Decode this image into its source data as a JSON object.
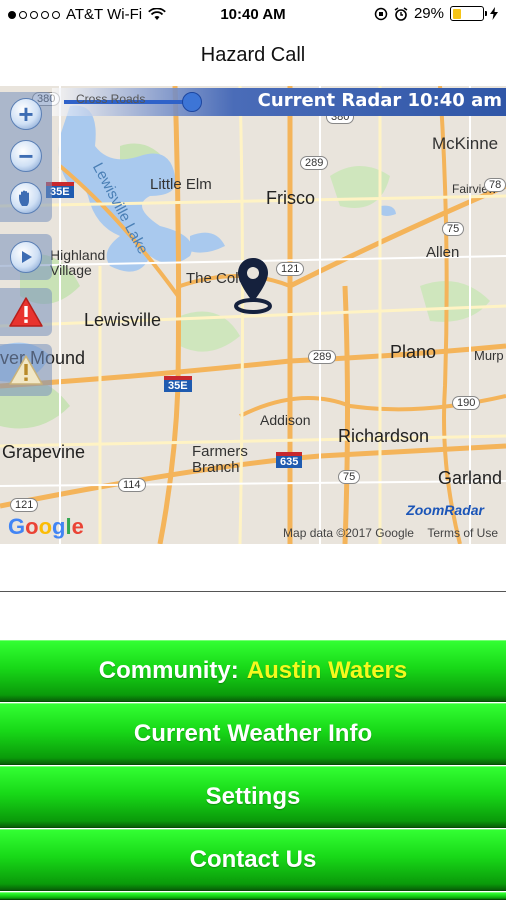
{
  "status_bar": {
    "carrier": "AT&T Wi-Fi",
    "time": "10:40 AM",
    "battery": "29%",
    "battery_level": 0.29,
    "signal_dots_filled": 1,
    "signal_dots_total": 5
  },
  "nav": {
    "title": "Hazard Call"
  },
  "map": {
    "radar_title": "Current Radar 10:40 am",
    "radar_road_label": "Cross Roads",
    "radar_shield": "75",
    "attribution": "Map data ©2017 Google",
    "terms": "Terms of Use",
    "google_logo": "Google",
    "zoomradar_logo": "ZoomRadar",
    "controls": {
      "zoom_in": "+",
      "zoom_out": "−",
      "pan": "hand-icon",
      "play": "play-icon",
      "alert": "!",
      "warning": "!"
    },
    "places": [
      {
        "key": "mckinney",
        "text": "McKinne"
      },
      {
        "key": "little_elm",
        "text": "Little Elm"
      },
      {
        "key": "frisco",
        "text": "Frisco"
      },
      {
        "key": "fairview",
        "text": "Fairview"
      },
      {
        "key": "highland_village",
        "text": "Highland Village"
      },
      {
        "key": "the_colony",
        "text": "The Colo"
      },
      {
        "key": "allen",
        "text": "Allen"
      },
      {
        "key": "lewisville",
        "text": "Lewisville"
      },
      {
        "key": "plano",
        "text": "Plano"
      },
      {
        "key": "murphy",
        "text": "Murp"
      },
      {
        "key": "flower_mound",
        "text": "ver Mound"
      },
      {
        "key": "addison",
        "text": "Addison"
      },
      {
        "key": "richardson",
        "text": "Richardson"
      },
      {
        "key": "grapevine",
        "text": "Grapevine"
      },
      {
        "key": "farmers_branch",
        "text": "Farmers Branch"
      },
      {
        "key": "garland",
        "text": "Garland"
      },
      {
        "key": "lewisville_lake",
        "text": "Lewisville Lake"
      }
    ],
    "shields": [
      "380",
      "380",
      "289",
      "121",
      "75",
      "289",
      "190",
      "635",
      "75",
      "114",
      "121",
      "35E",
      "35E",
      "78",
      "635"
    ]
  },
  "menu": {
    "community_label": "Community:",
    "community_value": "Austin Waters",
    "weather": "Current Weather Info",
    "settings": "Settings",
    "contact": "Contact Us"
  },
  "colors": {
    "button_green": "#18d818",
    "highlight_yellow": "#f4f91e",
    "radar_blue": "#2f56a7"
  }
}
